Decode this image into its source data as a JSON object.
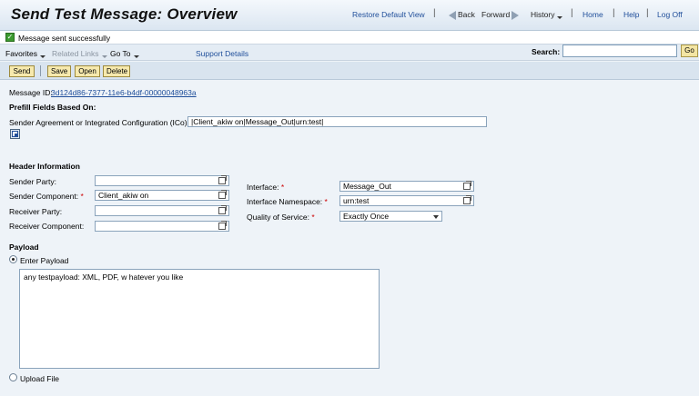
{
  "header": {
    "title": "Send Test Message: Overview",
    "nav": {
      "restore": "Restore Default View",
      "back": "Back",
      "forward": "Forward",
      "history": "History",
      "home": "Home",
      "help": "Help",
      "logoff": "Log Off"
    }
  },
  "message": {
    "text": "Message sent successfully",
    "icon": "check-icon"
  },
  "menu": {
    "favorites": "Favorites",
    "related_links": "Related Links",
    "goto": "Go To",
    "support": "Support Details",
    "search_label": "Search:",
    "search_value": "",
    "go": "Go"
  },
  "toolbar": {
    "send": "Send",
    "save": "Save",
    "open": "Open",
    "delete": "Delete"
  },
  "content": {
    "message_id_label": "Message ID:",
    "message_id": "3d124d86-7377-11e6-b4df-00000048963a",
    "prefill_heading": "Prefill Fields Based On:",
    "ico_label": "Sender Agreement or Integrated Configuration (ICo):",
    "ico_value": "|Client_akiw on|Message_Out|urn:test|",
    "header_info": "Header Information",
    "sender_party_label": "Sender Party:",
    "sender_party_value": "",
    "sender_component_label": "Sender Component:",
    "sender_component_value": "Client_akiw on",
    "receiver_party_label": "Receiver Party:",
    "receiver_party_value": "",
    "receiver_component_label": "Receiver Component:",
    "receiver_component_value": "",
    "interface_label": "Interface:",
    "interface_value": "Message_Out",
    "namespace_label": "Interface Namespace:",
    "namespace_value": "urn:test",
    "qos_label": "Quality of Service:",
    "qos_value": "Exactly Once",
    "required_mark": "*",
    "payload_heading": "Payload",
    "enter_payload": "Enter Payload",
    "payload_text": "any testpayload: XML, PDF, w hatever you like",
    "upload_file": "Upload File"
  }
}
